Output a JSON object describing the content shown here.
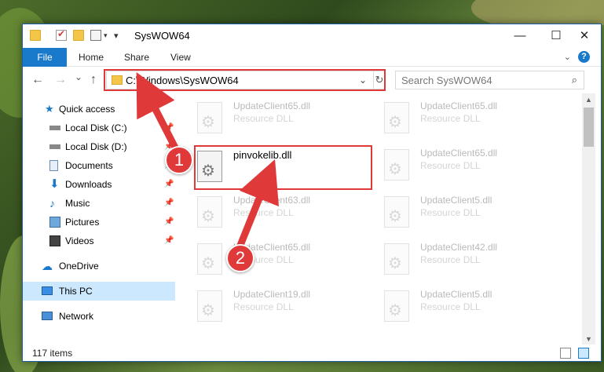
{
  "window": {
    "title": "SysWOW64",
    "minimize_glyph": "—",
    "maximize_glyph": "☐",
    "close_glyph": "✕"
  },
  "ribbon": {
    "tabs": [
      "File",
      "Home",
      "Share",
      "View"
    ],
    "help_glyph": "?",
    "expand_glyph": "⌄"
  },
  "nav": {
    "back_glyph": "←",
    "forward_glyph": "→",
    "recent_glyph": "⌄",
    "up_glyph": "↑",
    "address": "C:\\Windows\\SysWOW64",
    "address_chevron": "⌄",
    "refresh_glyph": "↻",
    "search_placeholder": "Search SysWOW64",
    "search_glyph": "⌕"
  },
  "sidebar": {
    "items": [
      {
        "label": "Quick access",
        "icon": "star-icon",
        "pinned": false
      },
      {
        "label": "Local Disk (C:)",
        "icon": "drive-icon",
        "pinned": true
      },
      {
        "label": "Local Disk (D:)",
        "icon": "drive-icon",
        "pinned": true
      },
      {
        "label": "Documents",
        "icon": "documents-icon",
        "pinned": true
      },
      {
        "label": "Downloads",
        "icon": "download-icon",
        "pinned": true
      },
      {
        "label": "Music",
        "icon": "music-icon",
        "pinned": true
      },
      {
        "label": "Pictures",
        "icon": "pictures-icon",
        "pinned": true
      },
      {
        "label": "Videos",
        "icon": "videos-icon",
        "pinned": true
      },
      {
        "label": "OneDrive",
        "icon": "cloud-icon",
        "pinned": false
      },
      {
        "label": "This PC",
        "icon": "computer-icon",
        "pinned": false,
        "selected": true
      },
      {
        "label": "Network",
        "icon": "network-icon",
        "pinned": false
      }
    ],
    "pin_glyph": "📌"
  },
  "files": {
    "left_column": [
      {
        "name": "UpdateClient65.dll",
        "type": "Resource DLL"
      },
      {
        "name": "UpdateClient63.dll",
        "type": "Resource DLL"
      },
      {
        "name": "UpdateClient65.dll",
        "type": "Resource DLL"
      },
      {
        "name": "UpdateClient19.dll",
        "type": "Resource DLL"
      }
    ],
    "right_column": [
      {
        "name": "UpdateClient65.dll",
        "type": "Resource DLL"
      },
      {
        "name": "UpdateClient65.dll",
        "type": "Resource DLL"
      },
      {
        "name": "UpdateClient5.dll",
        "type": "Resource DLL"
      },
      {
        "name": "UpdateClient42.dll",
        "type": "Resource DLL"
      },
      {
        "name": "UpdateClient5.dll",
        "type": "Resource DLL"
      }
    ],
    "highlighted": {
      "name": "pinvokelib.dll"
    }
  },
  "status": {
    "item_count": "117 items"
  },
  "annotations": {
    "step1": "1",
    "step2": "2",
    "color": "#e0393a"
  }
}
